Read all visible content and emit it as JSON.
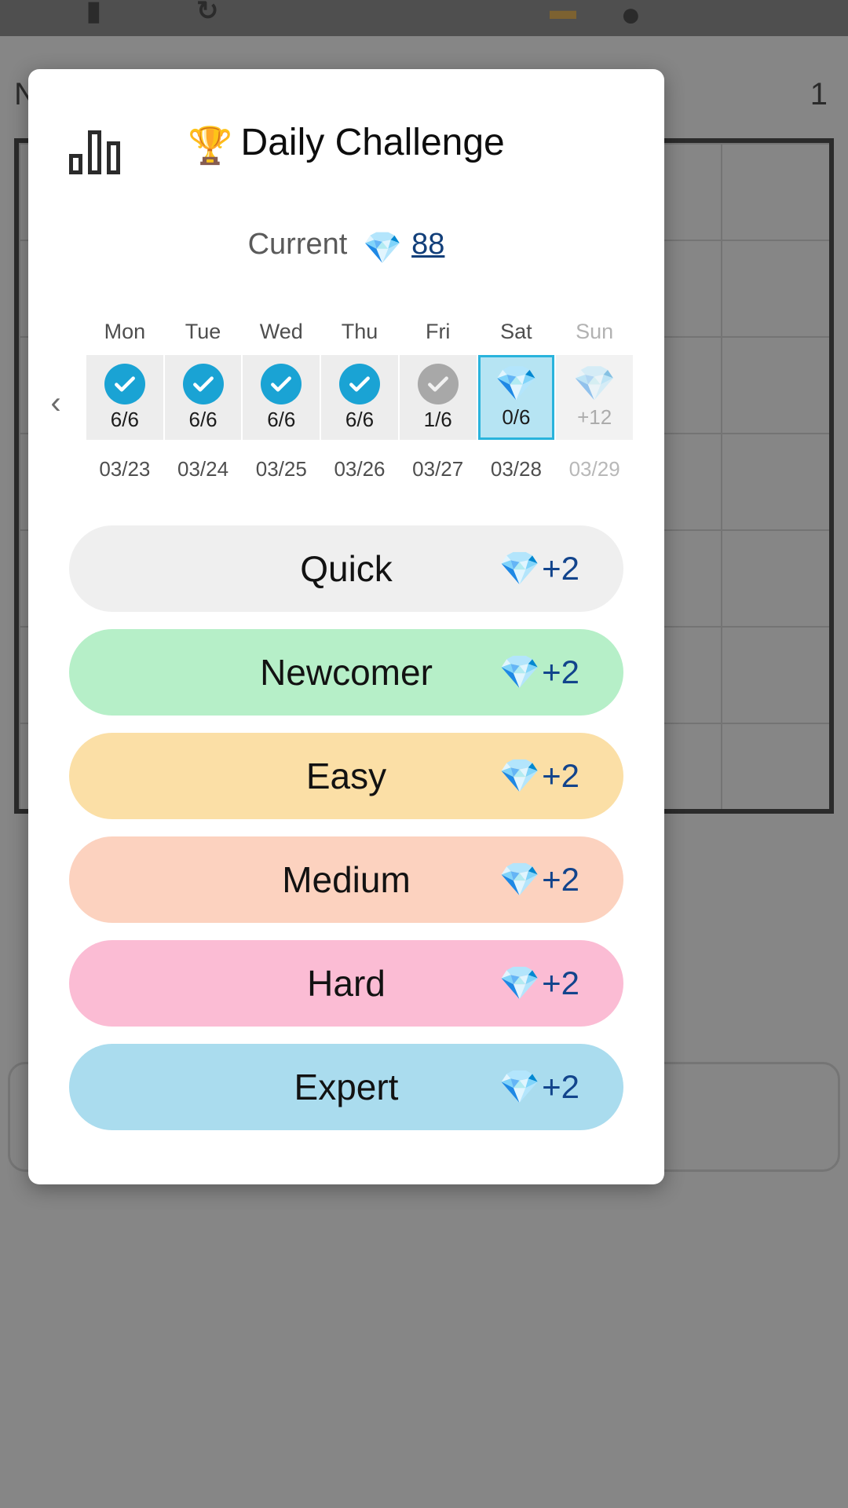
{
  "background": {
    "top_icons": [
      "▮",
      "↻",
      "▬",
      "●"
    ],
    "left_text": "N",
    "right_text": "1"
  },
  "modal": {
    "stats_icon": "bar-chart-icon",
    "title": "Daily Challenge",
    "title_emoji": "🏆",
    "current": {
      "label": "Current",
      "gem_icon": "💎",
      "amount": "88"
    },
    "prev_arrow": "‹",
    "week": {
      "days": [
        {
          "dow": "Mon",
          "date": "03/23",
          "progress": "6/6",
          "state": "complete",
          "icon": "check-icon",
          "muted": false
        },
        {
          "dow": "Tue",
          "date": "03/24",
          "progress": "6/6",
          "state": "complete",
          "icon": "check-icon",
          "muted": false
        },
        {
          "dow": "Wed",
          "date": "03/25",
          "progress": "6/6",
          "state": "complete",
          "icon": "check-icon",
          "muted": false
        },
        {
          "dow": "Thu",
          "date": "03/26",
          "progress": "6/6",
          "state": "complete",
          "icon": "check-icon",
          "muted": false
        },
        {
          "dow": "Fri",
          "date": "03/27",
          "progress": "1/6",
          "state": "partial",
          "icon": "check-icon-grey",
          "muted": false
        },
        {
          "dow": "Sat",
          "date": "03/28",
          "progress": "0/6",
          "state": "today",
          "icon": "gem-icon",
          "muted": false
        },
        {
          "dow": "Sun",
          "date": "03/29",
          "progress": "+12",
          "state": "future",
          "icon": "gem-icon-faded",
          "muted": true
        }
      ]
    },
    "difficulties": [
      {
        "label": "Quick",
        "reward": "+2",
        "gem": "💎",
        "color": "#efefef"
      },
      {
        "label": "Newcomer",
        "reward": "+2",
        "gem": "💎",
        "color": "#b6efc8"
      },
      {
        "label": "Easy",
        "reward": "+2",
        "gem": "💎",
        "color": "#fbdfa6"
      },
      {
        "label": "Medium",
        "reward": "+2",
        "gem": "💎",
        "color": "#fcd2bf"
      },
      {
        "label": "Hard",
        "reward": "+2",
        "gem": "💎",
        "color": "#fbbcd4"
      },
      {
        "label": "Expert",
        "reward": "+2",
        "gem": "💎",
        "color": "#aadcee"
      }
    ]
  },
  "colors": {
    "accent": "#29b3dc",
    "check": "#1aa3d4",
    "gem_text": "#12448c",
    "today_bg": "#b6e4f3"
  }
}
